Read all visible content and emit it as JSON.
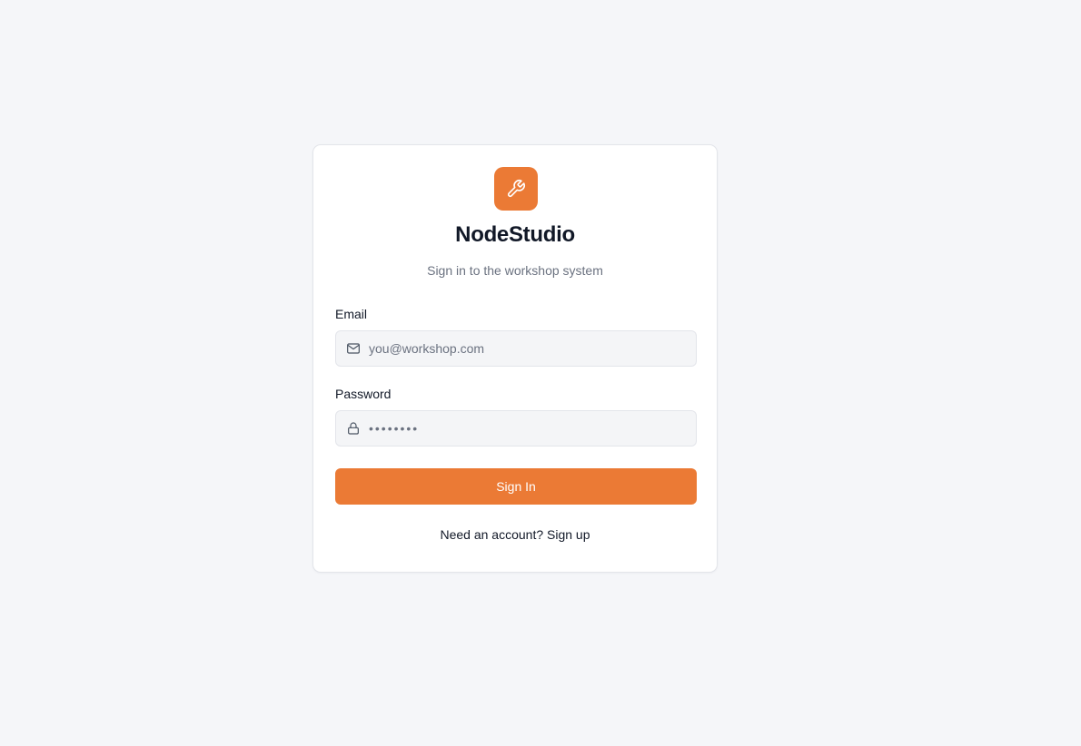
{
  "brand": {
    "name": "NodeStudio",
    "tagline": "Sign in to the workshop system",
    "logo_icon": "wrench-icon",
    "accent_color": "#eb7a35"
  },
  "form": {
    "email": {
      "label": "Email",
      "placeholder": "you@workshop.com",
      "value": "",
      "icon": "mail-icon"
    },
    "password": {
      "label": "Password",
      "placeholder": "••••••••",
      "value": "",
      "icon": "lock-icon"
    },
    "submit_label": "Sign In"
  },
  "footer": {
    "prompt": "Need an account?",
    "link_label": "Sign up"
  }
}
